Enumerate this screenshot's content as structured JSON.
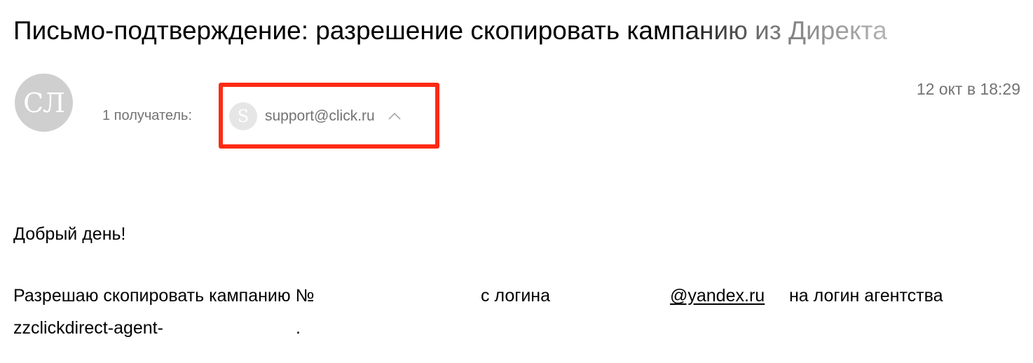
{
  "email": {
    "subject": "Письмо-подтверждение: разрешение скопировать кампанию из Директа",
    "sender_avatar_initials": "СЛ",
    "recipients_label": "1 получатель:",
    "recipient": {
      "avatar_letter": "S",
      "email": "support@click.ru"
    },
    "date": "12 окт в 18:29"
  },
  "body": {
    "greeting": "Добрый день!",
    "line1_start": "Разрешаю скопировать кампанию №",
    "line1_middle": "с логина",
    "line1_link": "@yandex.ru",
    "line1_end": "на логин агентства",
    "line2_start": "zzclickdirect-agent-",
    "line2_end": "."
  },
  "colors": {
    "highlight_border": "#ff2a14",
    "muted_text": "#737373",
    "avatar_bg": "#cfcfcf"
  },
  "icons": {
    "chevron": "chevron-up-icon"
  }
}
